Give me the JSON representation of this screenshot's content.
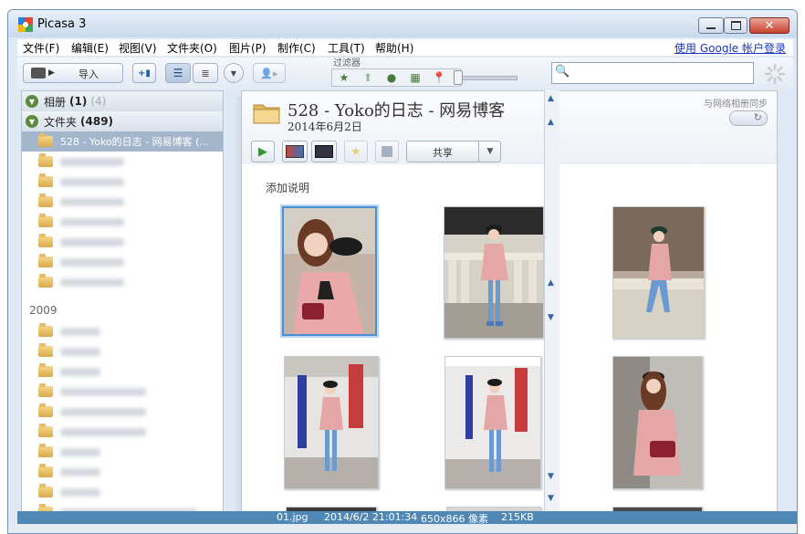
{
  "window": {
    "title": "Picasa 3"
  },
  "menu": {
    "items": [
      "文件(F)",
      "编辑(E)",
      "视图(V)",
      "文件夹(O)",
      "图片(P)",
      "制作(C)",
      "工具(T)",
      "帮助(H)"
    ],
    "account_link": "使用 Google 帐户登录"
  },
  "toolbar": {
    "import_label": "导入",
    "filter_label": "过滤器",
    "search_placeholder": ""
  },
  "sidebar": {
    "albums_label": "相册",
    "albums_count": "(1)",
    "albums_count_extra": "(4)",
    "folders_label": "文件夹",
    "folders_count": "(489)",
    "selected_folder": "528 - Yoko的日志 - 网易博客 (...",
    "year": "2009"
  },
  "album": {
    "title": "528 - Yoko的日志 - 网易博客",
    "date": "2014年6月2日",
    "sync_label": "与网络相册同步",
    "share_label": "共享",
    "caption_placeholder": "添加说明"
  },
  "status": {
    "filename": "01.jpg",
    "datetime": "2014/6/2 21:01:34",
    "dimensions": "650x866 像素",
    "filesize": "215KB"
  },
  "colors": {
    "selection": "#4a8fd4",
    "statusbar": "#4f88b5",
    "accent_green": "#5c8a3d"
  }
}
